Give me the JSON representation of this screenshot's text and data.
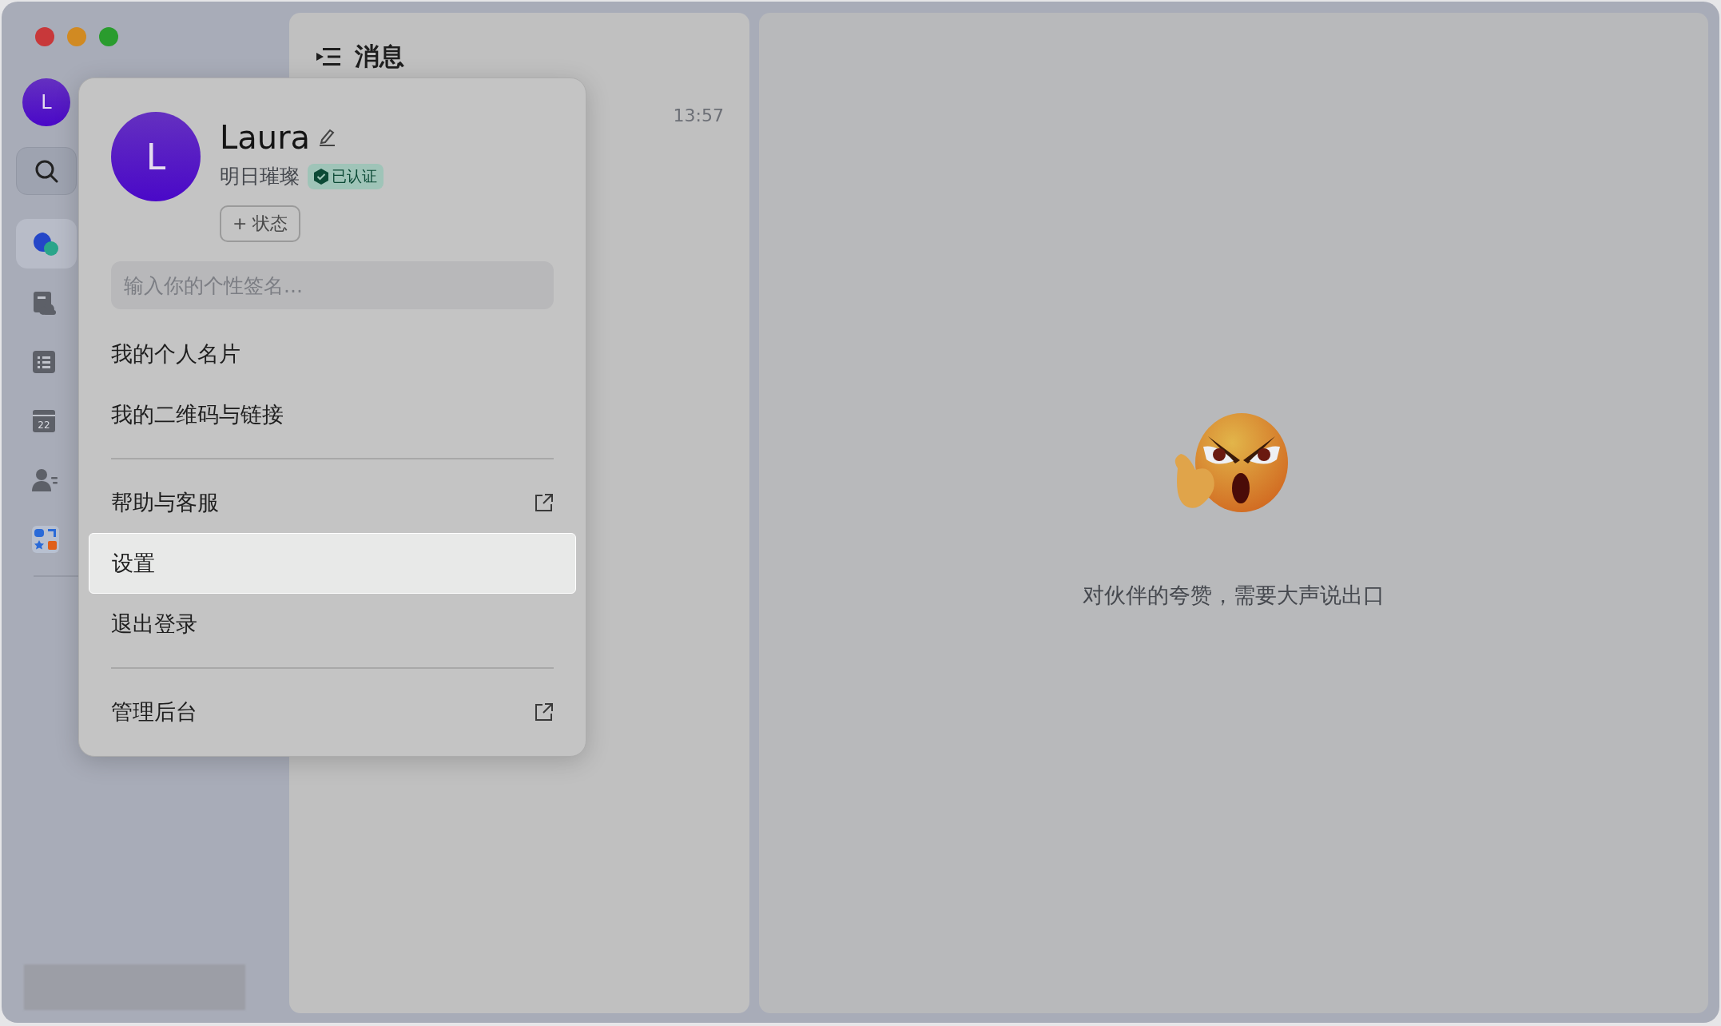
{
  "sidebar": {
    "avatar": "L",
    "nav": [
      {
        "kind": "chat",
        "selected": true
      },
      {
        "kind": "cloud-doc",
        "selected": false
      },
      {
        "kind": "list",
        "selected": false
      },
      {
        "kind": "calendar",
        "selected": false,
        "text": "22"
      },
      {
        "kind": "contacts",
        "selected": false
      },
      {
        "kind": "apps",
        "selected": false
      }
    ]
  },
  "messages": {
    "title": "消息",
    "time": "13:57"
  },
  "empty_state": {
    "text": "对伙伴的夸赞，需要大声说出口"
  },
  "profile_menu": {
    "avatar": "L",
    "name": "Laura",
    "organization": "明日璀璨",
    "badge": "已认证",
    "status_button": "+ 状态",
    "signature": {
      "placeholder": "输入你的个性签名..."
    },
    "sections": [
      [
        {
          "label": "我的个人名片",
          "kind": "plain",
          "selected": false
        },
        {
          "label": "我的二维码与链接",
          "kind": "plain",
          "selected": false
        }
      ],
      [
        {
          "label": "帮助与客服",
          "kind": "external",
          "selected": false
        },
        {
          "label": "设置",
          "kind": "plain",
          "selected": true
        },
        {
          "label": "退出登录",
          "kind": "plain",
          "selected": false
        }
      ],
      [
        {
          "label": "管理后台",
          "kind": "external",
          "selected": false
        }
      ]
    ]
  }
}
